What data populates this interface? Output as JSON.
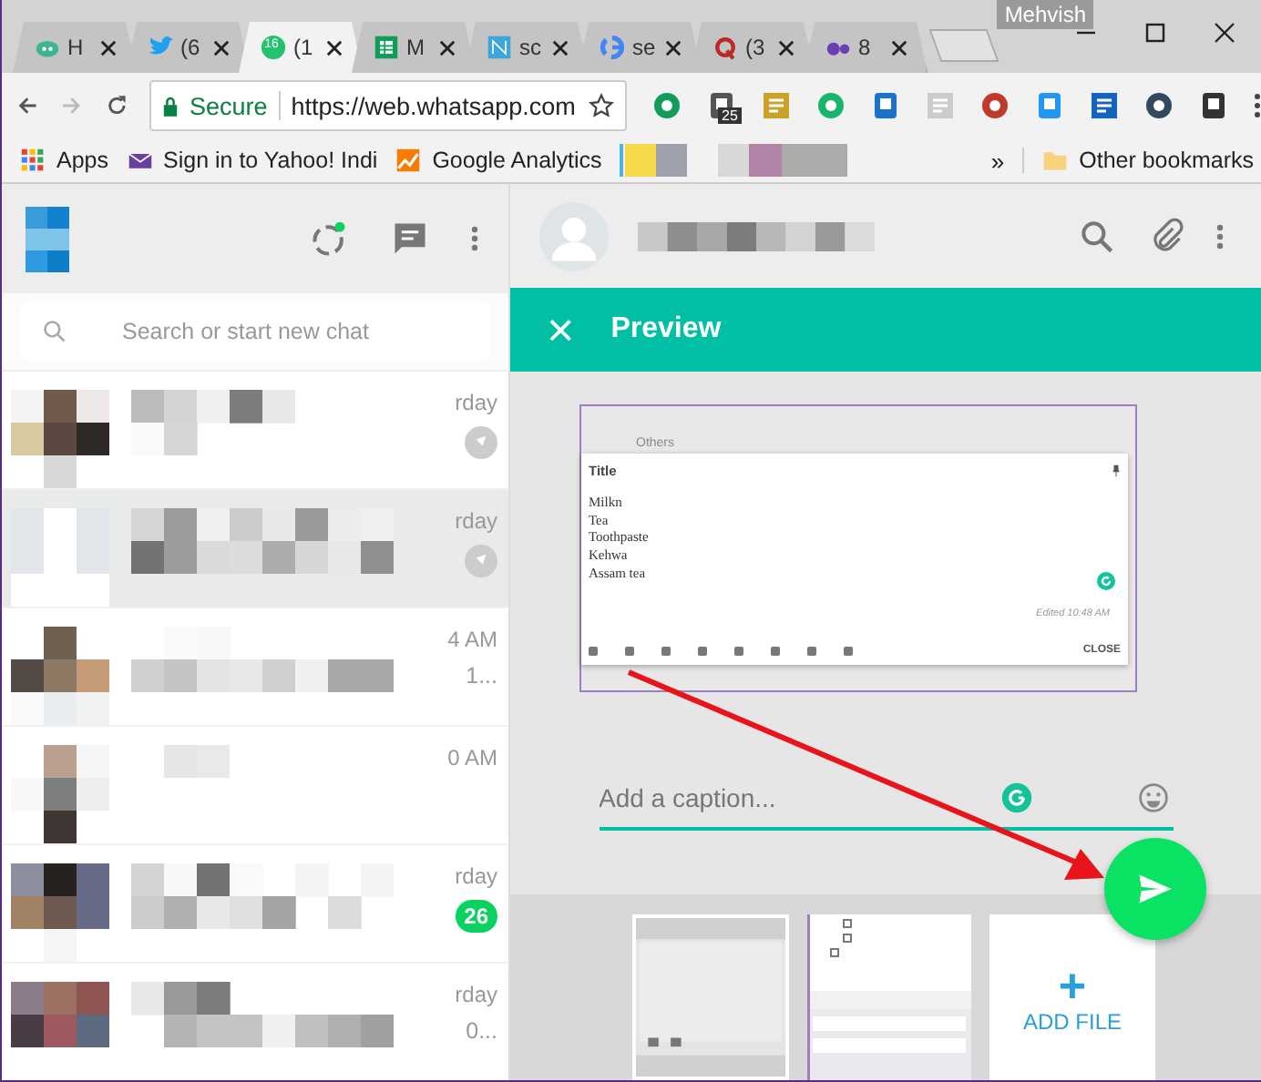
{
  "browser": {
    "profile_name": "Mehvish",
    "tabs": [
      {
        "label": "H",
        "kind": "cloud",
        "selected": false
      },
      {
        "label": "(6",
        "kind": "bird",
        "selected": false
      },
      {
        "label": "(1",
        "kind": "chat",
        "favicon_text": "16",
        "selected": true
      },
      {
        "label": "M",
        "kind": "sheet",
        "selected": false
      },
      {
        "label": "sc",
        "kind": "note",
        "selected": false
      },
      {
        "label": "se",
        "kind": "google",
        "selected": false
      },
      {
        "label": "(3",
        "kind": "quora",
        "selected": false
      },
      {
        "label": "8",
        "kind": "other",
        "selected": false
      }
    ],
    "address_bar": {
      "security": "Secure",
      "url": "https://web.whatsapp.com"
    },
    "extension_badge": "25",
    "bookmarks": [
      {
        "label": "Apps",
        "kind": "apps"
      },
      {
        "label": "Sign in to Yahoo! Indi",
        "kind": "mail"
      },
      {
        "label": "Google Analytics",
        "kind": "analytics"
      }
    ],
    "bookmarks_overflow": "»",
    "other_bookmarks": "Other bookmarks"
  },
  "chat_search": {
    "placeholder": "Search or start new chat"
  },
  "chats": [
    {
      "time": "rday",
      "pinned": true,
      "selected": false
    },
    {
      "time": "rday",
      "pinned": true,
      "selected": true
    },
    {
      "time": "4 AM",
      "preview_tail": "1...",
      "pinned": false,
      "selected": false
    },
    {
      "time": "0 AM",
      "pinned": false,
      "selected": false
    },
    {
      "time": "rday",
      "unread": "26",
      "pinned": false,
      "selected": false
    },
    {
      "time": "rday",
      "preview_tail": "0...",
      "pinned": false,
      "selected": false
    }
  ],
  "preview": {
    "title": "Preview",
    "close_icon": "×",
    "note": {
      "section": "Others",
      "title": "Title",
      "lines": [
        "Milkn",
        "Tea",
        "Toothpaste",
        "Kehwa",
        "Assam tea"
      ],
      "edited": "Edited 10:48 AM",
      "close": "CLOSE"
    },
    "caption": {
      "placeholder": "Add a caption..."
    },
    "add_file": {
      "icon": "+",
      "label": "ADD FILE"
    }
  }
}
